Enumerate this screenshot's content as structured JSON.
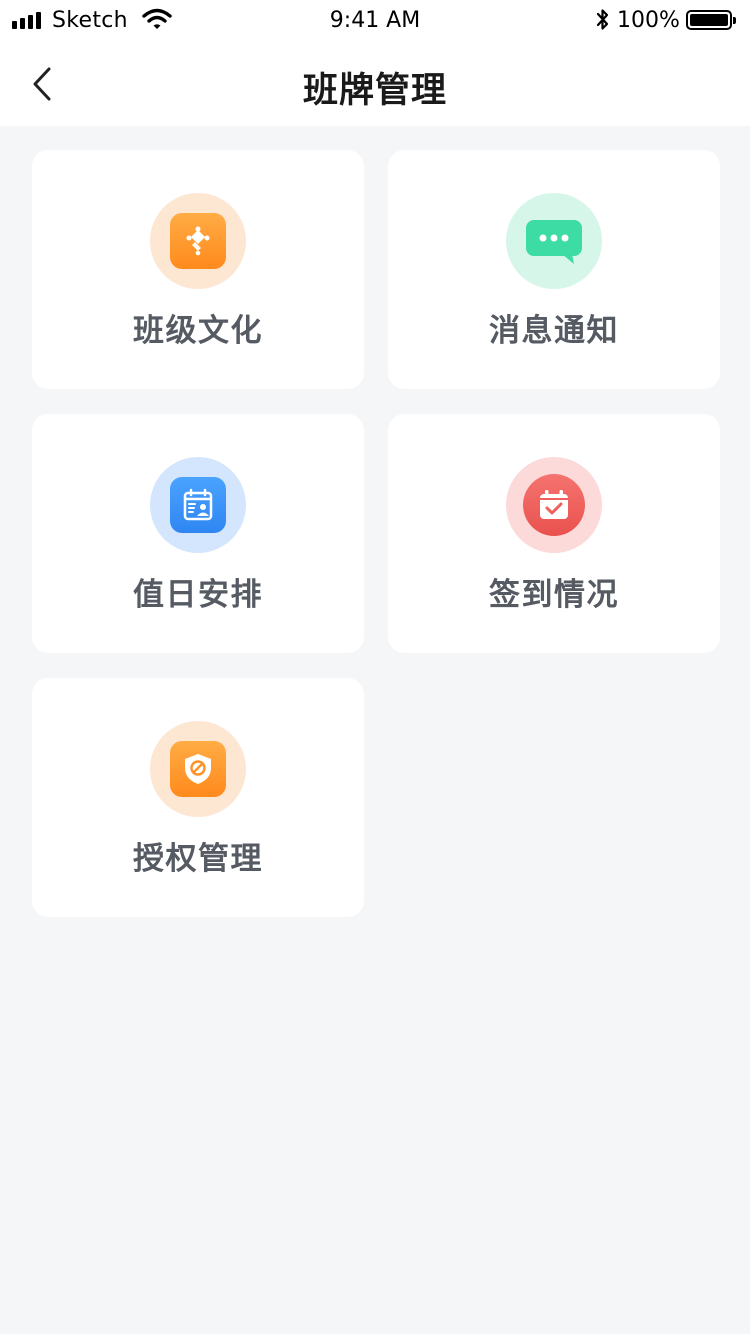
{
  "status_bar": {
    "carrier": "Sketch",
    "time": "9:41 AM",
    "battery": "100%"
  },
  "nav": {
    "title": "班牌管理",
    "back_icon": "chevron-left-icon"
  },
  "menu": {
    "items": [
      {
        "label": "班级文化",
        "icon": "puzzle-icon",
        "halo": "#fde6d2",
        "tile": "#ff9226"
      },
      {
        "label": "消息通知",
        "icon": "chat-bubble-icon",
        "halo": "#d6f6ea",
        "tile": "#3ddca4"
      },
      {
        "label": "值日安排",
        "icon": "calendar-person-icon",
        "halo": "#d4e6fd",
        "tile": "#3a93f7"
      },
      {
        "label": "签到情况",
        "icon": "calendar-check-icon",
        "halo": "#fcdada",
        "tile": "#f0615d"
      },
      {
        "label": "授权管理",
        "icon": "shield-icon",
        "halo": "#fde6d2",
        "tile": "#ff9226"
      }
    ]
  }
}
